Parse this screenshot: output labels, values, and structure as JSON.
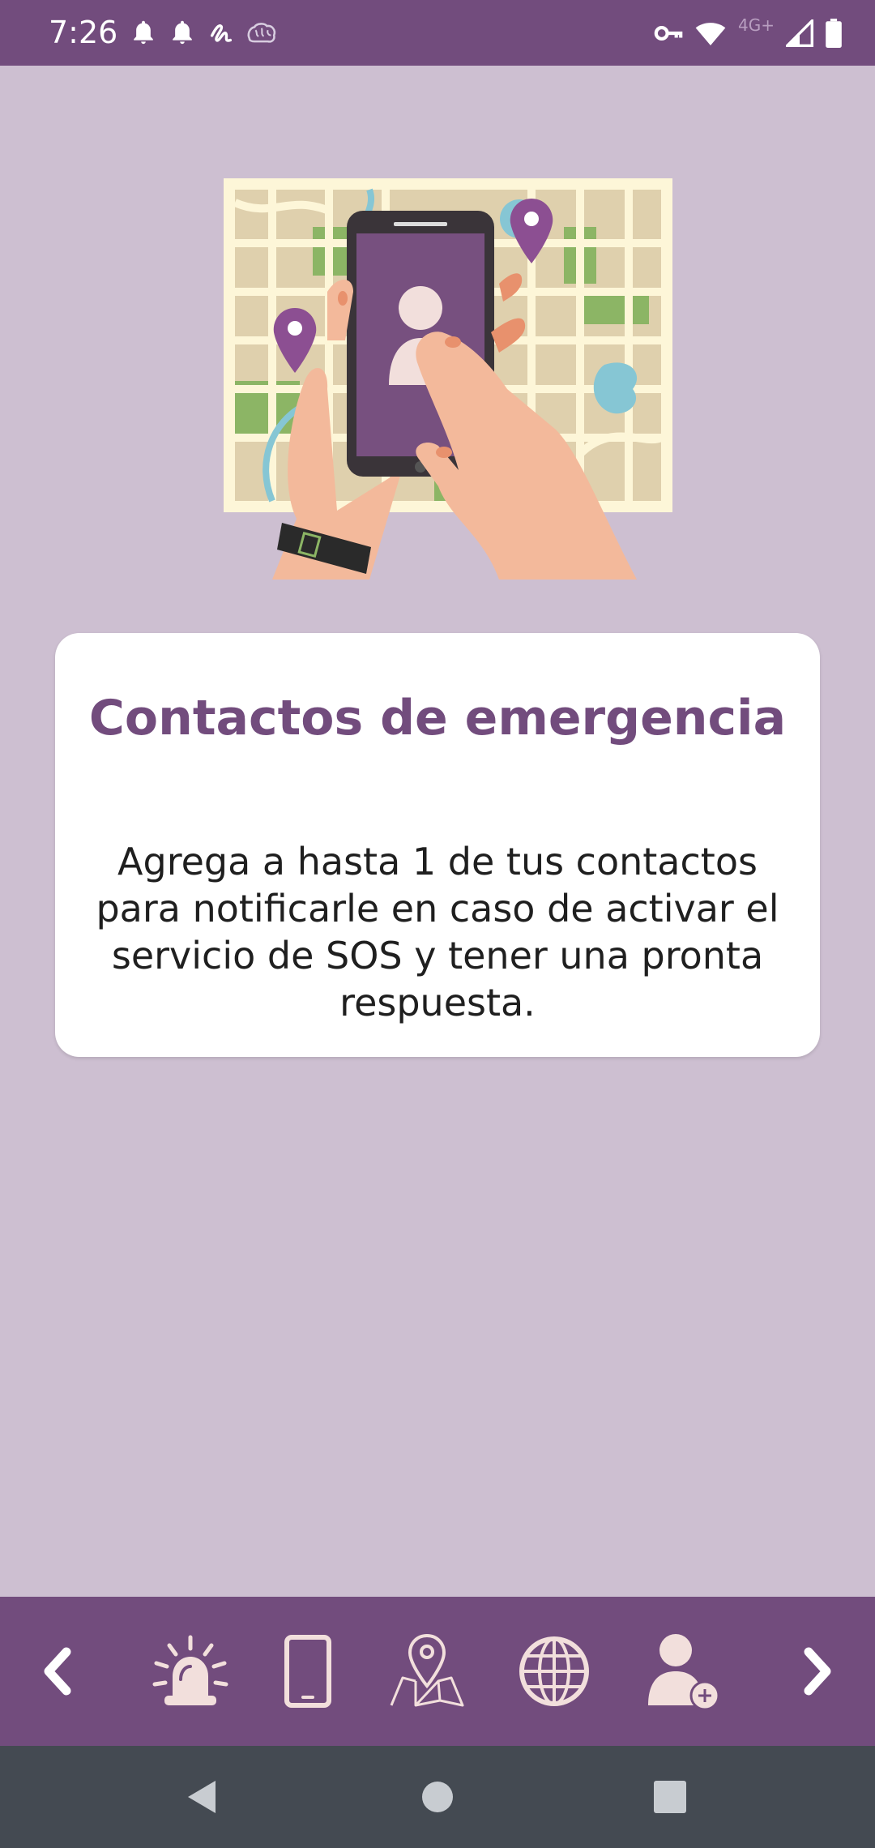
{
  "status_bar": {
    "time": "7:26",
    "network_label": "4G+",
    "left_icons": [
      "bell-icon",
      "bell-icon",
      "scribble-icon",
      "brain-icon"
    ],
    "right_icons": [
      "key-icon",
      "wifi-icon",
      "signal-icon",
      "battery-icon"
    ]
  },
  "illustration": {
    "icon": "map-phone-illustration"
  },
  "card": {
    "title": "Contactos de emergencia",
    "body": "Agrega a hasta 1 de tus contactos para notificarle en caso de activar el servicio de SOS y tener una pronta respuesta."
  },
  "toolbar": {
    "items": [
      "chevron-left-icon",
      "siren-icon",
      "smartphone-icon",
      "map-pin-icon",
      "globe-icon",
      "add-contact-icon",
      "chevron-right-icon"
    ]
  },
  "system_nav": {
    "items": [
      "back-icon",
      "home-icon",
      "recents-icon"
    ]
  },
  "colors": {
    "primary": "#724c7d",
    "background": "#cdbfd1",
    "card": "#ffffff",
    "icon_light": "#f2dfdc",
    "system_nav": "#444a52"
  }
}
